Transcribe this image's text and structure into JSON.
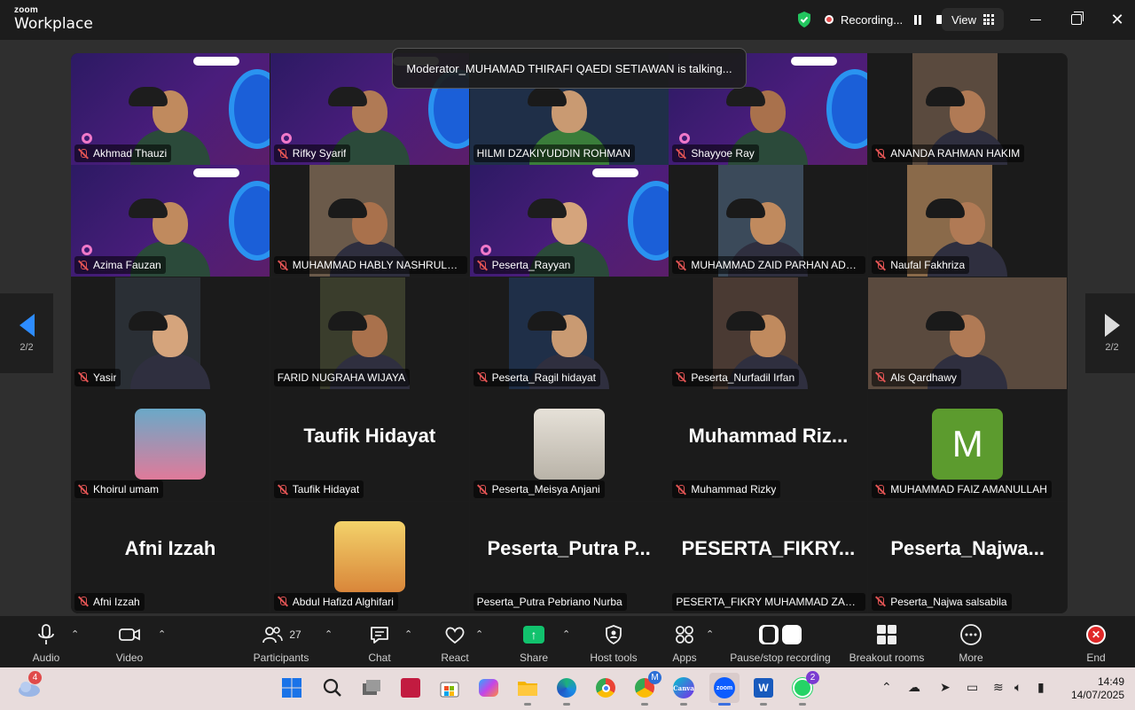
{
  "titlebar": {
    "logo_small": "zoom",
    "logo_big": "Workplace",
    "recording_label": "Recording...",
    "view_label": "View"
  },
  "talking_banner": "Moderator_MUHAMAD THIRAFI QAEDI SETIAWAN is talking...",
  "pagination": {
    "left": "2/2",
    "right": "2/2"
  },
  "participants": [
    {
      "name": "Akhmad Thauzi",
      "muted": true,
      "type": "webinar"
    },
    {
      "name": "Rifky Syarif",
      "muted": true,
      "type": "webinar"
    },
    {
      "name": "HILMI DZAKIYUDDIN ROHMAN",
      "muted": false,
      "type": "video"
    },
    {
      "name": "Shayyoe Ray",
      "muted": true,
      "type": "webinar"
    },
    {
      "name": "ANANDA RAHMAN HAKIM",
      "muted": true,
      "type": "narrow"
    },
    {
      "name": "Azima Fauzan",
      "muted": true,
      "type": "webinar"
    },
    {
      "name": "MUHAMMAD HABLY NASHRULLAH",
      "muted": true,
      "type": "narrow"
    },
    {
      "name": "Peserta_Rayyan",
      "muted": true,
      "type": "webinar"
    },
    {
      "name": "MUHAMMAD ZAID PARHAN ADRI...",
      "muted": true,
      "type": "narrow"
    },
    {
      "name": "Naufal Fakhriza",
      "muted": true,
      "type": "narrow"
    },
    {
      "name": "Yasir",
      "muted": true,
      "type": "narrow"
    },
    {
      "name": "FARID NUGRAHA WIJAYA",
      "muted": false,
      "type": "narrow"
    },
    {
      "name": "Peserta_Ragil hidayat",
      "muted": true,
      "type": "narrow"
    },
    {
      "name": "Peserta_Nurfadil Irfan",
      "muted": true,
      "type": "narrow"
    },
    {
      "name": "Als Qardhawy",
      "muted": true,
      "type": "video"
    },
    {
      "name": "Khoirul umam",
      "muted": true,
      "type": "avatar"
    },
    {
      "name": "Taufik Hidayat",
      "muted": true,
      "type": "name",
      "display": "Taufik Hidayat"
    },
    {
      "name": "Peserta_Meisya Anjani",
      "muted": true,
      "type": "avatar"
    },
    {
      "name": "Muhammad Rizky",
      "muted": true,
      "type": "name",
      "display": "Muhammad  Riz..."
    },
    {
      "name": "MUHAMMAD FAIZ AMANULLAH",
      "muted": true,
      "type": "letter",
      "display": "M"
    },
    {
      "name": "Afni Izzah",
      "muted": true,
      "type": "name",
      "display": "Afni Izzah"
    },
    {
      "name": "Abdul Hafizd Alghifari",
      "muted": true,
      "type": "avatar"
    },
    {
      "name": "Peserta_Putra Pebriano Nurba",
      "muted": false,
      "type": "name",
      "display": "Peserta_Putra  P..."
    },
    {
      "name": "PESERTA_FIKRY MUHAMMAD ZAHRAN",
      "muted": false,
      "type": "name",
      "display": "PESERTA_FIKRY..."
    },
    {
      "name": "Peserta_Najwa salsabila",
      "muted": true,
      "type": "name",
      "display": "Peserta_Najwa..."
    }
  ],
  "toolbar": {
    "audio": "Audio",
    "video": "Video",
    "participants": "Participants",
    "participants_count": "27",
    "chat": "Chat",
    "react": "React",
    "share": "Share",
    "host_tools": "Host tools",
    "apps": "Apps",
    "pause_stop": "Pause/stop recording",
    "breakout": "Breakout rooms",
    "more": "More",
    "end": "End"
  },
  "taskbar": {
    "weather_badge": "4",
    "teams_badge": "M",
    "whatsapp_badge": "2",
    "time": "14:49",
    "date": "14/07/2025"
  },
  "colors": {
    "accent_blue": "#2d8cff",
    "share_green": "#11c26d",
    "end_red": "#e02828",
    "mute_red": "#e25454"
  }
}
